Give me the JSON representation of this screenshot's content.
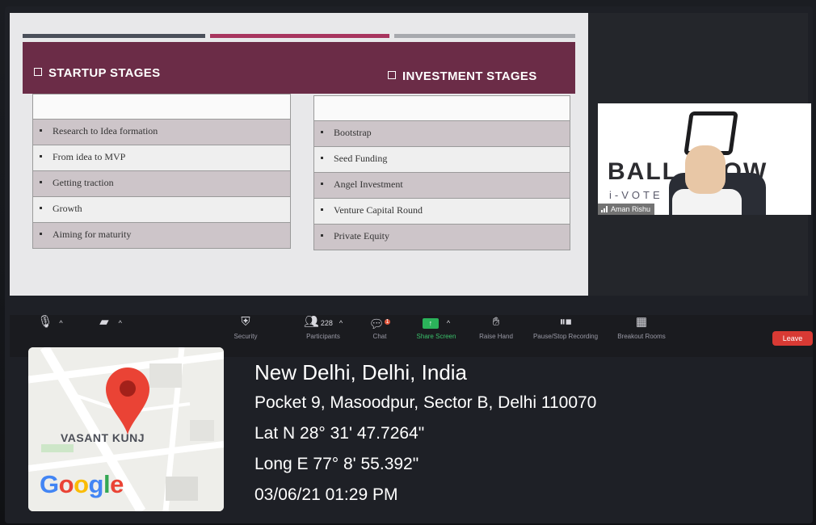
{
  "slide": {
    "left_heading": "STARTUP STAGES",
    "right_heading": "INVESTMENT STAGES",
    "startup_stages": [
      "Research to Idea formation",
      "From idea to MVP",
      "Getting traction",
      "Growth",
      "Aiming for maturity"
    ],
    "investment_stages": [
      "Bootstrap",
      "Seed Funding",
      "Angel Investment",
      "Venture Capital Round",
      "Private Equity"
    ],
    "colors": {
      "header": "#6b2c47",
      "bar1": "#4a4f5a",
      "bar2": "#a8355f",
      "bar3": "#a7a9ae"
    }
  },
  "video": {
    "participant_name": "Aman Rishu",
    "logo_text": "BALL   NOW",
    "logo_sub": "i-VOTE            URE"
  },
  "toolbar": {
    "mute_icon": "microphone-muted-icon",
    "video_icon": "camera-off-icon",
    "security": "Security",
    "participants": "Participants",
    "participant_count": "228",
    "chat": "Chat",
    "chat_badge": "1",
    "share_screen": "Share Screen",
    "raise_hand": "Raise Hand",
    "recording": "Pause/Stop Recording",
    "breakout": "Breakout Rooms",
    "leave": "Leave"
  },
  "geotag": {
    "map_area": "VASANT KUNJ",
    "brand": "Google",
    "city": "New Delhi, Delhi, India",
    "address": "Pocket 9, Masoodpur, Sector B, Delhi 110070",
    "lat": "Lat N 28° 31' 47.7264\"",
    "long": "Long E 77° 8' 55.392\"",
    "datetime": "03/06/21 01:29 PM"
  }
}
